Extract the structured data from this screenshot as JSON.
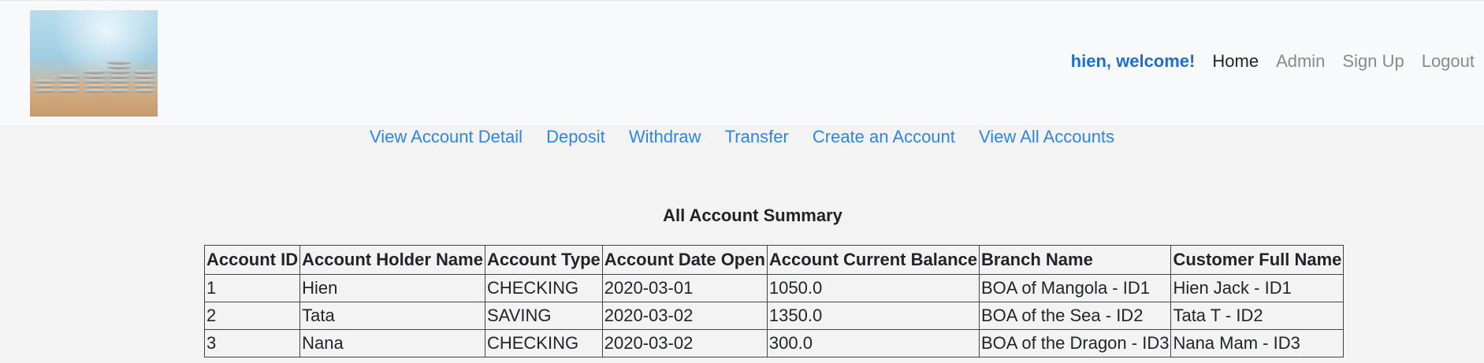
{
  "header": {
    "logo_alt": "coins stacks logo",
    "welcome": "hien, welcome!",
    "nav": [
      {
        "label": "Home",
        "active": true
      },
      {
        "label": "Admin",
        "active": false
      },
      {
        "label": "Sign Up",
        "active": false
      },
      {
        "label": "Logout",
        "active": false
      }
    ]
  },
  "subnav": {
    "items": [
      "View Account Detail",
      "Deposit",
      "Withdraw",
      "Transfer",
      "Create an Account",
      "View All Accounts"
    ]
  },
  "summary": {
    "title": "All Account Summary",
    "columns": [
      "Account ID",
      "Account Holder Name",
      "Account Type",
      "Account Date Open",
      "Account Current Balance",
      "Branch Name",
      "Customer Full Name"
    ],
    "rows": [
      [
        "1",
        "Hien",
        "CHECKING",
        "2020-03-01",
        "1050.0",
        "BOA of Mangola - ID1",
        "Hien Jack - ID1"
      ],
      [
        "2",
        "Tata",
        "SAVING",
        "2020-03-02",
        "1350.0",
        "BOA of the Sea - ID2",
        "Tata T - ID2"
      ],
      [
        "3",
        "Nana",
        "CHECKING",
        "2020-03-02",
        "300.0",
        "BOA of the Dragon - ID3",
        "Nana Mam - ID3"
      ]
    ]
  },
  "colors": {
    "accent": "#2f86e0",
    "welcome": "#1f6fc8",
    "nav_muted": "#8a8a8a"
  }
}
